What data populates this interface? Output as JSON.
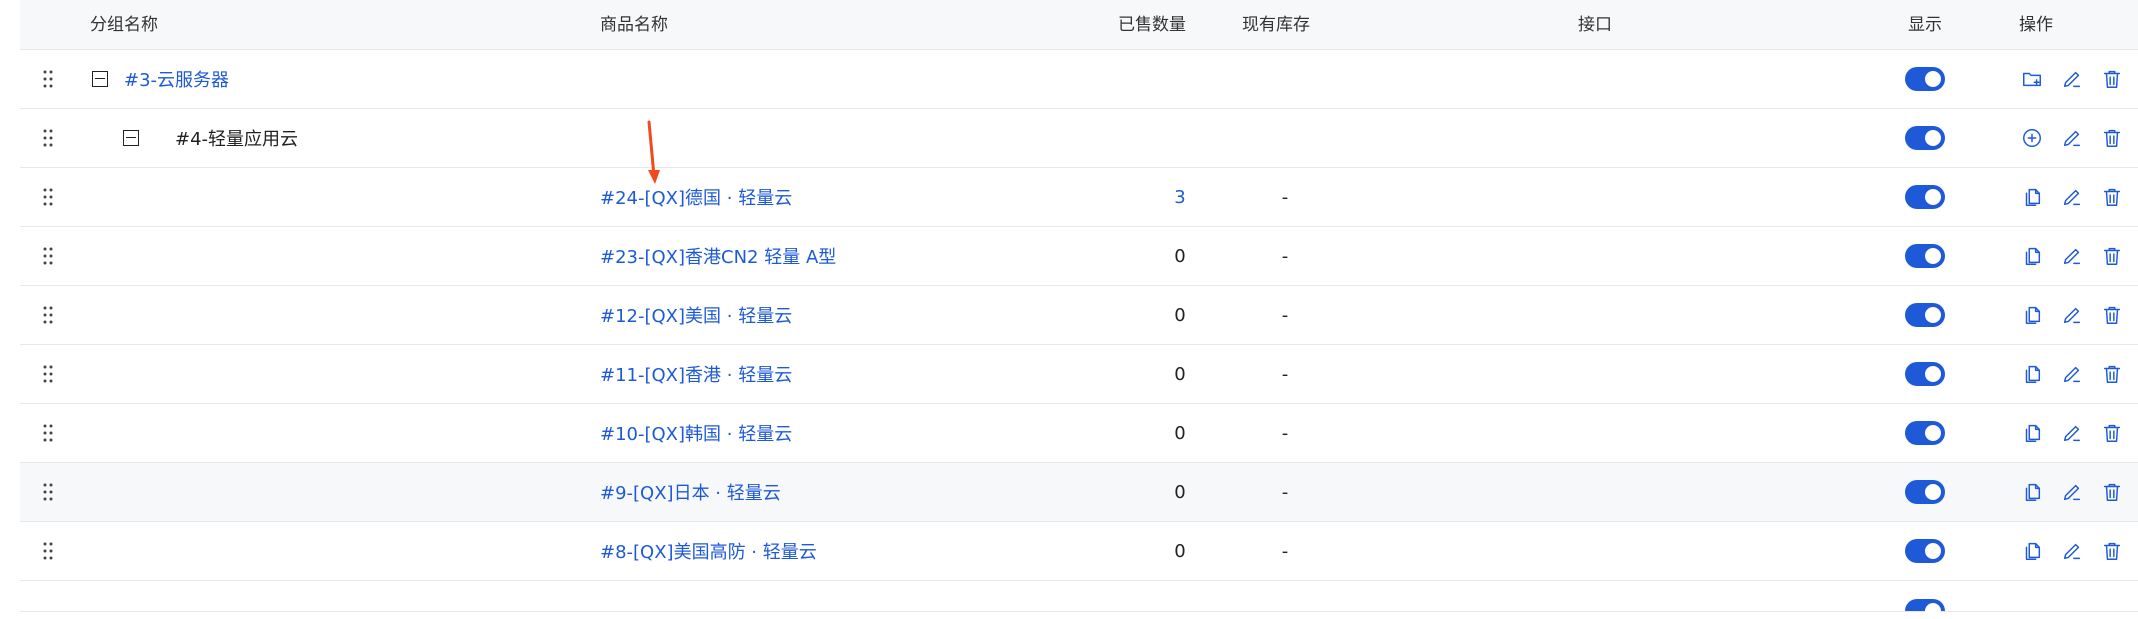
{
  "header": {
    "group_name": "分组名称",
    "product_name": "商品名称",
    "sold": "已售数量",
    "stock": "现有库存",
    "interface": "接口",
    "display": "显示",
    "actions": "操作"
  },
  "groups": [
    {
      "label": "#3-云服务器"
    },
    {
      "label": "#4-轻量应用云"
    }
  ],
  "products": [
    {
      "name": "#24-[QX]德国 · 轻量云",
      "sold": "3",
      "stock": "-"
    },
    {
      "name": "#23-[QX]香港CN2 轻量 A型",
      "sold": "0",
      "stock": "-"
    },
    {
      "name": "#12-[QX]美国 · 轻量云",
      "sold": "0",
      "stock": "-"
    },
    {
      "name": "#11-[QX]香港 · 轻量云",
      "sold": "0",
      "stock": "-"
    },
    {
      "name": "#10-[QX]韩国 · 轻量云",
      "sold": "0",
      "stock": "-"
    },
    {
      "name": "#9-[QX]日本 · 轻量云",
      "sold": "0",
      "stock": "-"
    },
    {
      "name": "#8-[QX]美国高防 · 轻量云",
      "sold": "0",
      "stock": "-"
    }
  ],
  "colors": {
    "accent": "#1e5ad7",
    "annotation": "#f04a1d"
  }
}
